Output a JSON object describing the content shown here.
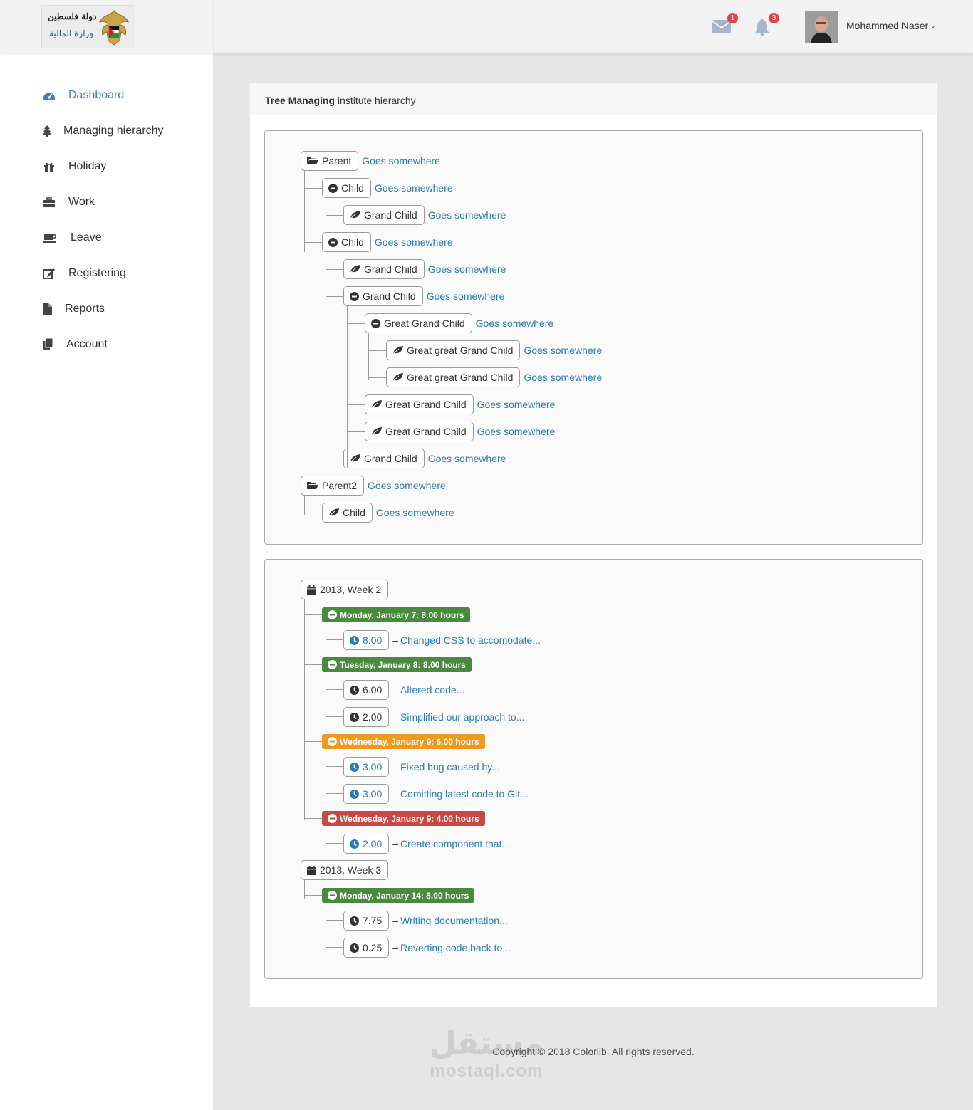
{
  "header": {
    "logo_text_line1": "دولة فلسطين",
    "logo_text_line2": "وزارة المالية",
    "mail_count": "1",
    "notif_count": "3",
    "user_name": "Mohammed Naser"
  },
  "sidebar": {
    "items": [
      {
        "label": "Dashboard",
        "icon": "dashboard-icon"
      },
      {
        "label": "Managing hierarchy",
        "icon": "tree-icon"
      },
      {
        "label": "Holiday",
        "icon": "gift-icon"
      },
      {
        "label": "Work",
        "icon": "briefcase-icon"
      },
      {
        "label": "Leave",
        "icon": "coffee-icon"
      },
      {
        "label": "Registering",
        "icon": "edit-icon"
      },
      {
        "label": "Reports",
        "icon": "file-icon"
      },
      {
        "label": "Account",
        "icon": "copy-icon"
      }
    ]
  },
  "panel": {
    "title_bold": "Tree Managing",
    "title_rest": " institute hierarchy"
  },
  "tree1": [
    {
      "label": "Parent",
      "link": "Goes somewhere",
      "icon": "folder-open-icon"
    },
    {
      "label": "Child",
      "link": "Goes somewhere",
      "icon": "minus-sign-icon"
    },
    {
      "label": "Grand Child",
      "link": "Goes somewhere",
      "icon": "leaf-icon"
    },
    {
      "label": "Child",
      "link": "Goes somewhere",
      "icon": "minus-sign-icon"
    },
    {
      "label": "Grand Child",
      "link": "Goes somewhere",
      "icon": "leaf-icon"
    },
    {
      "label": "Grand Child",
      "link": "Goes somewhere",
      "icon": "minus-sign-icon"
    },
    {
      "label": "Great Grand Child",
      "link": "Goes somewhere",
      "icon": "minus-sign-icon"
    },
    {
      "label": "Great great Grand Child",
      "link": "Goes somewhere",
      "icon": "leaf-icon"
    },
    {
      "label": "Great great Grand Child",
      "link": "Goes somewhere",
      "icon": "leaf-icon"
    },
    {
      "label": "Great Grand Child",
      "link": "Goes somewhere",
      "icon": "leaf-icon"
    },
    {
      "label": "Great Grand Child",
      "link": "Goes somewhere",
      "icon": "leaf-icon"
    },
    {
      "label": "Grand Child",
      "link": "Goes somewhere",
      "icon": "leaf-icon"
    },
    {
      "label": "Parent2",
      "link": "Goes somewhere",
      "icon": "folder-open-icon"
    },
    {
      "label": "Child",
      "link": "Goes somewhere",
      "icon": "leaf-icon"
    }
  ],
  "tree2": [
    {
      "kind": "week",
      "label": "2013, Week 2",
      "icon": "calendar-icon"
    },
    {
      "kind": "day",
      "label": "Monday, January 7: 8.00 hours",
      "color": "#4a8a3f",
      "icon": "minus-sign-icon"
    },
    {
      "kind": "task",
      "hours": "8.00",
      "desc": "Changed CSS to accomodate...",
      "hours_color": "#2a7ab8",
      "icon": "time-icon"
    },
    {
      "kind": "day",
      "label": "Tuesday, January 8: 8.00 hours",
      "color": "#4a8a3f",
      "icon": "minus-sign-icon"
    },
    {
      "kind": "task",
      "hours": "6.00",
      "desc": "Altered code...",
      "hours_color": "#333333",
      "icon": "time-icon"
    },
    {
      "kind": "task",
      "hours": "2.00",
      "desc": "Simplified our approach to...",
      "hours_color": "#333333",
      "icon": "time-icon"
    },
    {
      "kind": "day",
      "label": "Wednesday, January 9: 6.00 hours",
      "color": "#ee9a1c",
      "icon": "minus-sign-icon"
    },
    {
      "kind": "task",
      "hours": "3.00",
      "desc": "Fixed bug caused by...",
      "hours_color": "#2a7ab8",
      "icon": "time-icon"
    },
    {
      "kind": "task",
      "hours": "3.00",
      "desc": "Comitting latest code to Git...",
      "hours_color": "#2a7ab8",
      "icon": "time-icon"
    },
    {
      "kind": "day",
      "label": "Wednesday, January 9: 4.00 hours",
      "color": "#c84943",
      "icon": "minus-sign-icon"
    },
    {
      "kind": "task",
      "hours": "2.00",
      "desc": "Create component that...",
      "hours_color": "#2a7ab8",
      "icon": "time-icon"
    },
    {
      "kind": "week",
      "label": "2013, Week 3",
      "icon": "calendar-icon"
    },
    {
      "kind": "day",
      "label": "Monday, January 14: 8.00 hours",
      "color": "#4a8a3f",
      "icon": "minus-sign-icon"
    },
    {
      "kind": "task",
      "hours": "7.75",
      "desc": "Writing documentation...",
      "hours_color": "#333333",
      "icon": "time-icon"
    },
    {
      "kind": "task",
      "hours": "0.25",
      "desc": "Reverting code back to...",
      "hours_color": "#333333",
      "icon": "time-icon"
    }
  ],
  "footer": {
    "copyright": "Copyright © 2018 Colorlib. All rights reserved.",
    "watermark_ar": "مستقل",
    "watermark_en": "mostaql.com"
  }
}
